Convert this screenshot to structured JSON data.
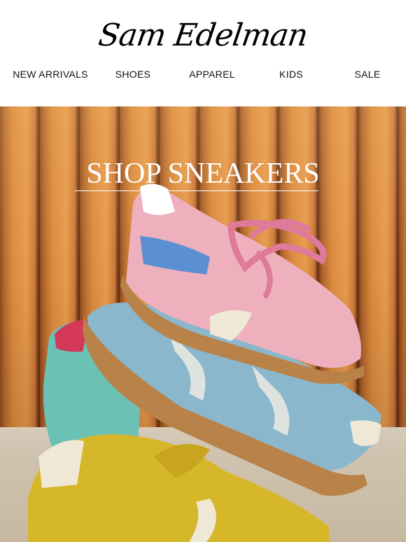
{
  "brand": {
    "logo_text": "Sam Edelman"
  },
  "nav": {
    "items": [
      {
        "label": "NEW ARRIVALS"
      },
      {
        "label": "SHOES"
      },
      {
        "label": "APPAREL"
      },
      {
        "label": "KIDS"
      },
      {
        "label": "SALE"
      }
    ]
  },
  "hero": {
    "title": "SHOP SNEAKERS",
    "colors": {
      "pink_shoe": "#eeb0bd",
      "blue_shoe": "#8ab7cc",
      "yellow_shoe": "#d7b72a",
      "teal_shoe": "#6cc1b5",
      "gum_sole": "#b98248"
    }
  }
}
